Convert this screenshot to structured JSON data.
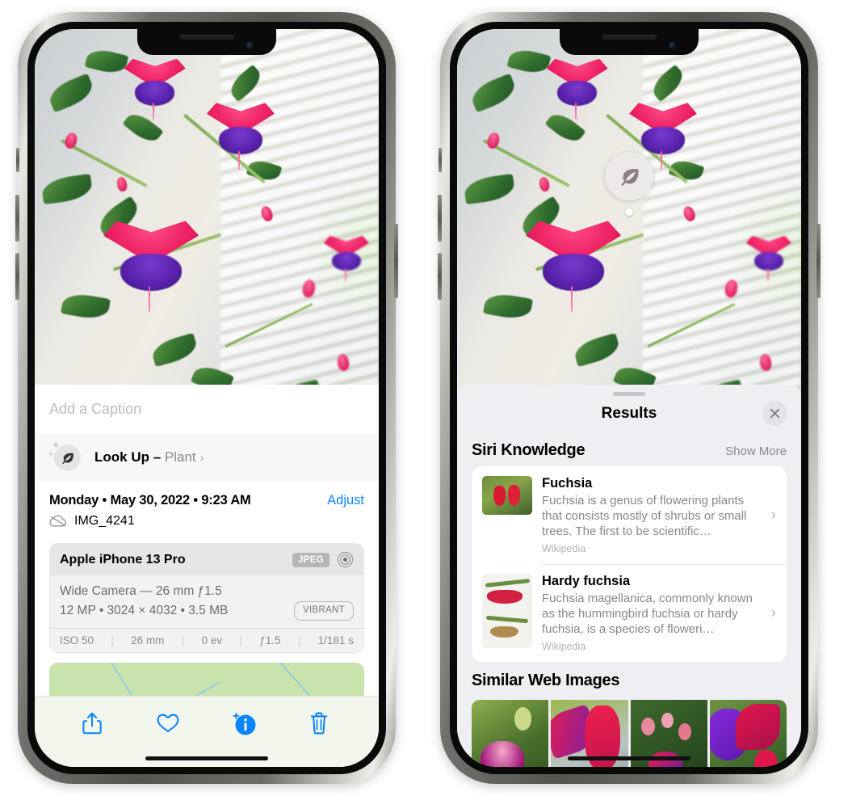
{
  "left_phone": {
    "caption": {
      "placeholder": "Add a Caption",
      "value": ""
    },
    "lookup_row": {
      "icon": "leaf-icon",
      "label": "Look Up –",
      "subject": "Plant",
      "chevron": "›"
    },
    "metadata": {
      "datetime": "Monday • May 30, 2022 • 9:23 AM",
      "adjust_label": "Adjust",
      "cloud_icon": "icloud-slash-icon",
      "filename": "IMG_4241"
    },
    "camera_card": {
      "model": "Apple iPhone 13 Pro",
      "format_badge": "JPEG",
      "lens_icon": "aperture-icon",
      "lens_line": "Wide Camera — 26 mm ƒ1.5",
      "specs_line": "12 MP • 3024 × 4032 • 3.5 MB",
      "style_badge": "VIBRANT",
      "exif": [
        "ISO 50",
        "26 mm",
        "0 ev",
        "ƒ1.5",
        "1/181 s"
      ]
    },
    "map": {
      "pin": "photo-thumbnail-pin"
    },
    "toolbar": [
      {
        "name": "share-button",
        "icon": "share-icon"
      },
      {
        "name": "favorite-button",
        "icon": "heart-icon"
      },
      {
        "name": "info-button",
        "icon": "info-sparkle-icon"
      },
      {
        "name": "delete-button",
        "icon": "trash-icon"
      }
    ]
  },
  "right_phone": {
    "visual_lookup_badge": {
      "icon": "leaf-icon"
    },
    "sheet": {
      "title": "Results",
      "close_icon": "close-icon",
      "siri_knowledge": {
        "title": "Siri Knowledge",
        "show_more": "Show More",
        "results": [
          {
            "title": "Fuchsia",
            "snippet": "Fuchsia is a genus of flowering plants that consists mostly of shrubs or small trees. The first to be scientific…",
            "source": "Wikipedia",
            "chevron": "›"
          },
          {
            "title": "Hardy fuchsia",
            "snippet": "Fuchsia magellanica, commonly known as the hummingbird fuchsia or hardy fuchsia, is a species of floweri…",
            "source": "Wikipedia",
            "chevron": "›"
          }
        ]
      },
      "similar_web_images": {
        "title": "Similar Web Images",
        "count": 4
      }
    }
  },
  "colors": {
    "accent_blue": "#0a84ff",
    "sheet_bg": "#efeff3",
    "card_bg": "#ffffff",
    "toolbar_bg": "#f3f6ec",
    "secondary_text": "#8a8a8f"
  }
}
